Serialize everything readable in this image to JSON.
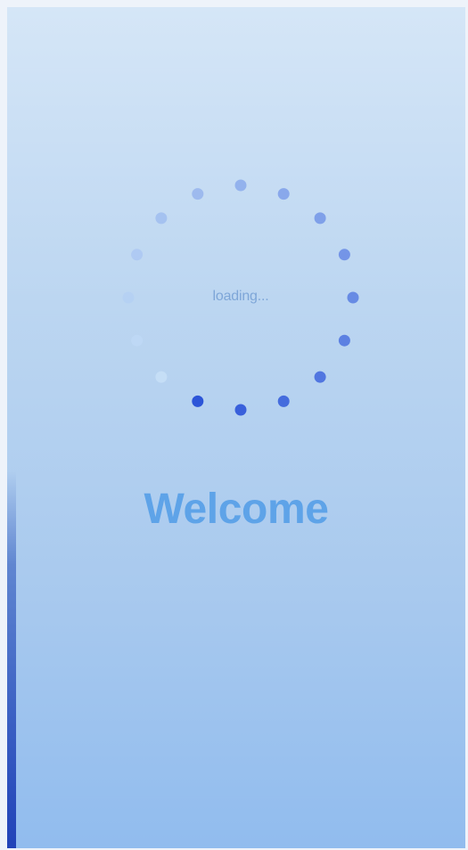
{
  "screen": {
    "loading_text": "loading...",
    "welcome_text": "Welcome"
  },
  "spinner": {
    "dot_count": 16,
    "active_color": "#2c55d8",
    "fade_color": "#c9e2f8"
  }
}
